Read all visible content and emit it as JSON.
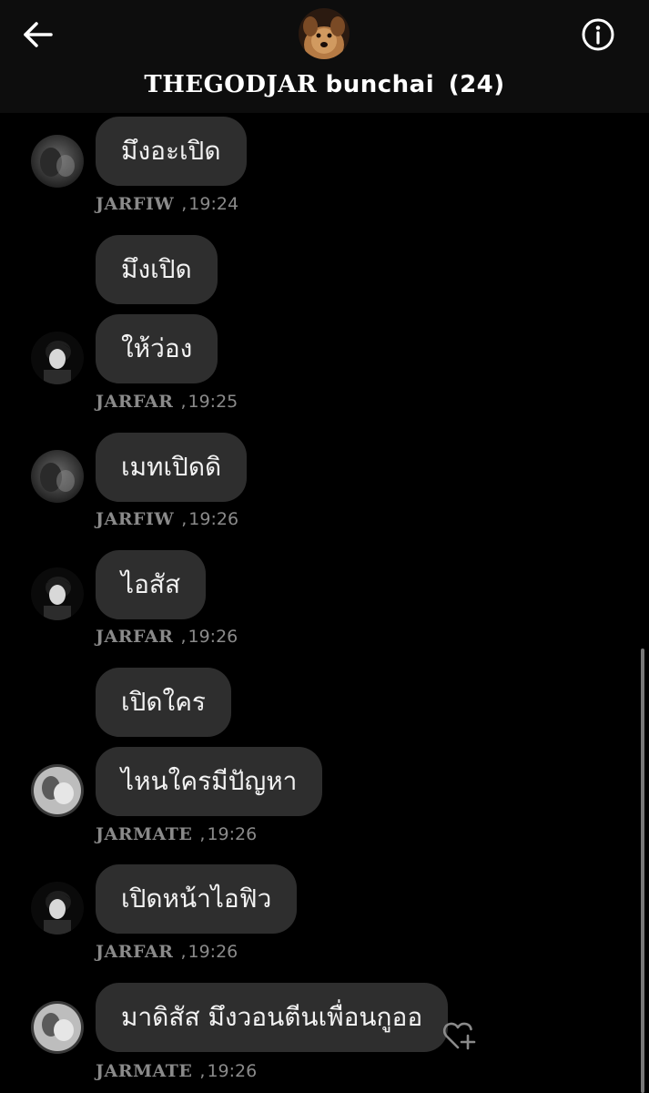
{
  "header": {
    "title_part1": "THEGODJAR",
    "title_part2": "bunchai",
    "member_count": "(24)",
    "back_icon": "arrow-left-icon",
    "info_icon": "info-circle-icon"
  },
  "messages": [
    {
      "text": "มึงอะเปิด"
    },
    {
      "sender": "JARFIW",
      "separator": ",",
      "time": "19:24"
    },
    {
      "text": "มึงเปิด"
    },
    {
      "text": "ให้ว่อง"
    },
    {
      "sender": "JARFAR",
      "separator": ",",
      "time": "19:25"
    },
    {
      "text": "เมทเปิดดิ"
    },
    {
      "sender": "JARFIW",
      "separator": ",",
      "time": "19:26"
    },
    {
      "text": "ไอสัส"
    },
    {
      "sender": "JARFAR",
      "separator": ",",
      "time": "19:26"
    },
    {
      "text": "เปิดใคร"
    },
    {
      "text": "ไหนใครมีปัญหา"
    },
    {
      "sender": "JARMATE",
      "separator": ",",
      "time": "19:26"
    },
    {
      "text": "เปิดหน้าไอฟิว"
    },
    {
      "sender": "JARFAR",
      "separator": ",",
      "time": "19:26"
    },
    {
      "text": "มาดิสัส มึงวอนตีนเพื่อนกูออ"
    },
    {
      "sender": "JARMATE",
      "separator": ",",
      "time": "19:26"
    }
  ],
  "reaction": {
    "icon": "heart-plus-icon"
  },
  "colors": {
    "background": "#000000",
    "header_background": "#0d0d0d",
    "bubble": "#2e2e2e",
    "meta_text": "#8a8a8a"
  }
}
